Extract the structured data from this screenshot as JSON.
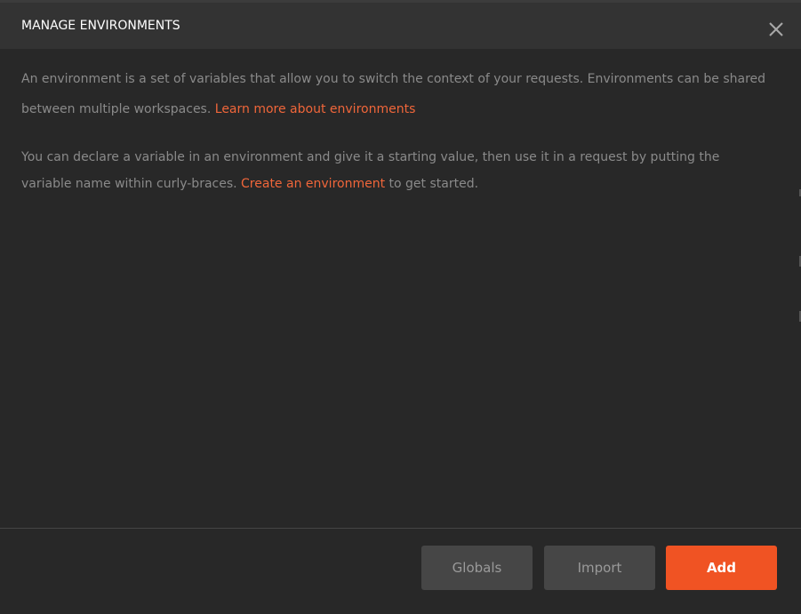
{
  "dialog": {
    "title": "MANAGE ENVIRONMENTS",
    "close_icon": "close-icon"
  },
  "body": {
    "paragraph1": {
      "text": "An environment is a set of variables that allow you to switch the context of your requests. Environments can be shared between multiple workspaces. ",
      "link": "Learn more about environments"
    },
    "paragraph2": {
      "text_before": "You can declare a variable in an environment and give it a starting value, then use it in a request by putting the variable name within curly-braces. ",
      "link": "Create an environment",
      "text_after": " to get started."
    }
  },
  "footer": {
    "globals_label": "Globals",
    "import_label": "Import",
    "add_label": "Add"
  },
  "colors": {
    "accent": "#f05323",
    "link": "#f0663a",
    "background": "#282828",
    "header": "#333333"
  }
}
